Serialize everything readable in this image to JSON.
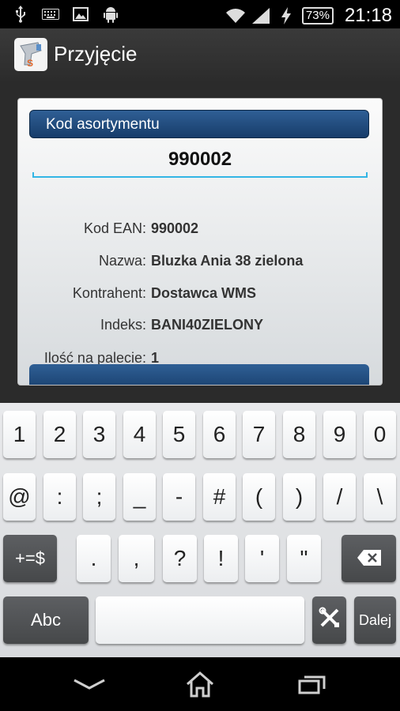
{
  "status_bar": {
    "icons": [
      "usb-icon",
      "keyboard-icon",
      "image-icon",
      "android-icon",
      "wifi-icon",
      "signal-icon",
      "charging-icon"
    ],
    "battery": "73%",
    "time": "21:18"
  },
  "app": {
    "title": "Przyjęcie",
    "icon": "barcode-scanner-icon"
  },
  "form": {
    "header": "Kod asortymentu",
    "code_value": "990002",
    "rows": [
      {
        "label": "Kod EAN:",
        "value": "990002"
      },
      {
        "label": "Nazwa:",
        "value": "Bluzka Ania 38 zielona"
      },
      {
        "label": "Kontrahent:",
        "value": "Dostawca WMS"
      },
      {
        "label": "Indeks:",
        "value": "BANI40ZIELONY"
      },
      {
        "label": "Ilość na palecie:",
        "value": "1"
      }
    ]
  },
  "keyboard": {
    "row1": [
      "1",
      "2",
      "3",
      "4",
      "5",
      "6",
      "7",
      "8",
      "9",
      "0"
    ],
    "row2": [
      "@",
      ":",
      ";",
      "_",
      "-",
      "#",
      "(",
      ")",
      "/",
      "\\"
    ],
    "row3_mode": "+=$",
    "row3": [
      ".",
      ",",
      "?",
      "!",
      "'",
      "\""
    ],
    "abc": "Abc",
    "done": "Dalej",
    "backspace_icon": "backspace-icon",
    "settings_icon": "tools-icon"
  },
  "navbar": {
    "icons": [
      "back-chevron-icon",
      "home-icon",
      "recent-apps-icon"
    ]
  }
}
